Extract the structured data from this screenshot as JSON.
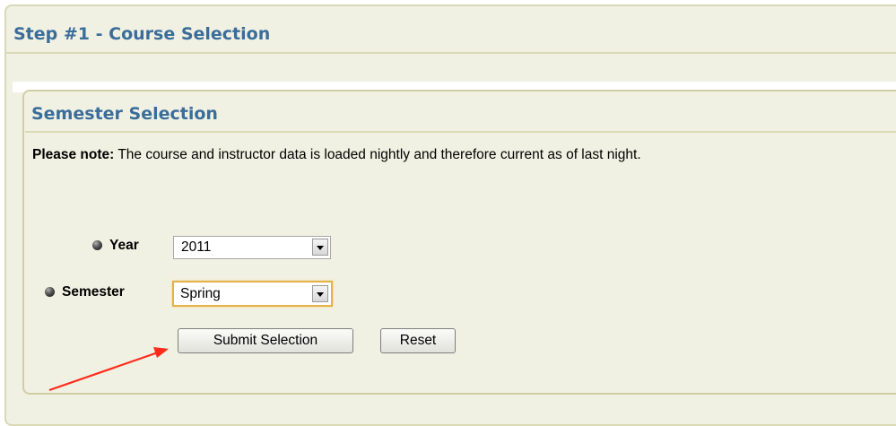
{
  "step": {
    "title": "Step #1 - Course Selection"
  },
  "semester_selection": {
    "title": "Semester Selection",
    "note_label": "Please note:",
    "note_text": " The course and instructor data is loaded nightly and therefore current as of last night."
  },
  "form": {
    "year": {
      "label": "Year",
      "value": "2011"
    },
    "semester": {
      "label": "Semester",
      "value": "Spring"
    },
    "submit_label": "Submit Selection",
    "reset_label": "Reset"
  },
  "colors": {
    "heading": "#3a6d9a",
    "panel_background": "#f1f1e3",
    "panel_border": "#d9d9b6",
    "focus_border": "#e3b24a",
    "annotation_arrow": "#ff2a1a"
  },
  "icons": {
    "bullet": "bullet-icon",
    "dropdown": "chevron-down-icon",
    "annotation": "annotation-arrow-icon"
  }
}
